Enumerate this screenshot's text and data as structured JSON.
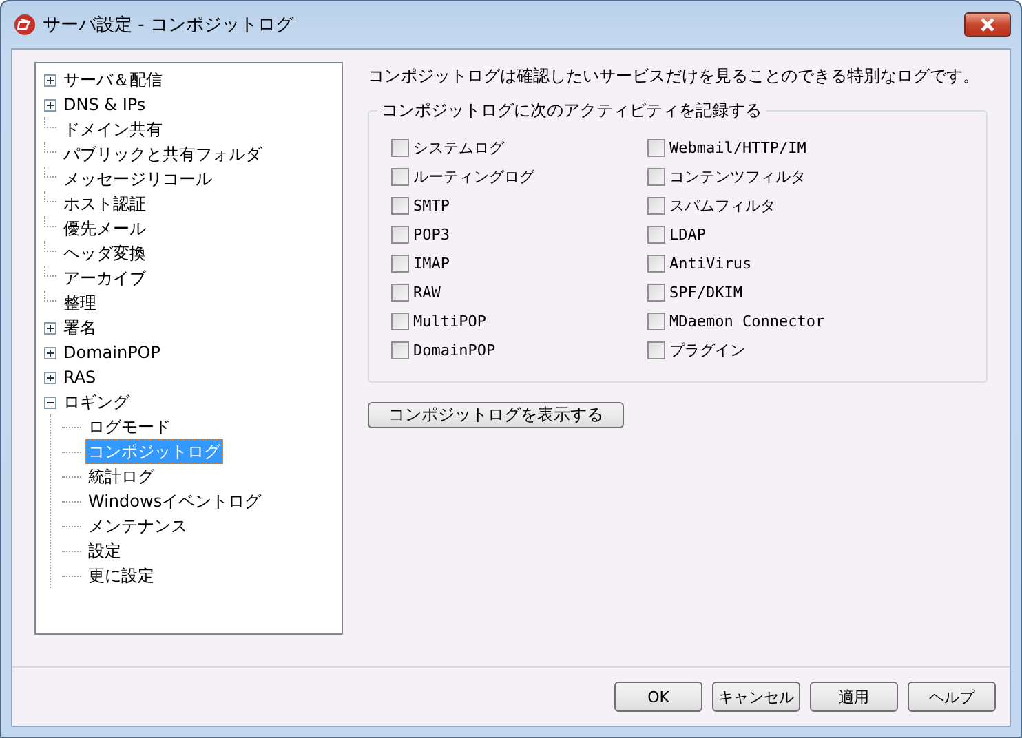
{
  "window": {
    "title": "サーバ設定 - コンポジットログ"
  },
  "tree": [
    {
      "label": "サーバ＆配信",
      "expanded": false,
      "selected": false
    },
    {
      "label": "DNS & IPs",
      "expanded": false,
      "selected": false
    },
    {
      "label": "ドメイン共有",
      "selected": false
    },
    {
      "label": "パブリックと共有フォルダ",
      "selected": false
    },
    {
      "label": "メッセージリコール",
      "selected": false
    },
    {
      "label": "ホスト認証",
      "selected": false
    },
    {
      "label": "優先メール",
      "selected": false
    },
    {
      "label": "ヘッダ変換",
      "selected": false
    },
    {
      "label": "アーカイブ",
      "selected": false
    },
    {
      "label": "整理",
      "selected": false
    },
    {
      "label": "署名",
      "expanded": false,
      "selected": false
    },
    {
      "label": "DomainPOP",
      "expanded": false,
      "selected": false
    },
    {
      "label": "RAS",
      "expanded": false,
      "selected": false
    },
    {
      "label": "ロギング",
      "expanded": true,
      "selected": false,
      "children": [
        {
          "label": "ログモード",
          "selected": false
        },
        {
          "label": "コンポジットログ",
          "selected": true
        },
        {
          "label": "統計ログ",
          "selected": false
        },
        {
          "label": "Windowsイベントログ",
          "selected": false
        },
        {
          "label": "メンテナンス",
          "selected": false
        },
        {
          "label": "設定",
          "selected": false
        },
        {
          "label": "更に設定",
          "selected": false
        }
      ]
    }
  ],
  "description": "コンポジットログは確認したいサービスだけを見ることのできる特別なログです。",
  "group": {
    "title": "コンポジットログに次のアクティビティを記録する",
    "columns": [
      [
        {
          "label": "システムログ",
          "checked": false
        },
        {
          "label": "ルーティングログ",
          "checked": false
        },
        {
          "label": "SMTP",
          "checked": false
        },
        {
          "label": "POP3",
          "checked": false
        },
        {
          "label": "IMAP",
          "checked": false
        },
        {
          "label": "RAW",
          "checked": false
        },
        {
          "label": "MultiPOP",
          "checked": false
        },
        {
          "label": "DomainPOP",
          "checked": false
        }
      ],
      [
        {
          "label": "Webmail/HTTP/IM",
          "checked": false
        },
        {
          "label": "コンテンツフィルタ",
          "checked": false
        },
        {
          "label": "スパムフィルタ",
          "checked": false
        },
        {
          "label": "LDAP",
          "checked": false
        },
        {
          "label": "AntiVirus",
          "checked": false
        },
        {
          "label": "SPF/DKIM",
          "checked": false
        },
        {
          "label": "MDaemon Connector",
          "checked": false
        },
        {
          "label": "プラグイン",
          "checked": false
        }
      ]
    ]
  },
  "show_button": "コンポジットログを表示する",
  "buttons": [
    "OK",
    "キャンセル",
    "適用",
    "ヘルプ"
  ]
}
